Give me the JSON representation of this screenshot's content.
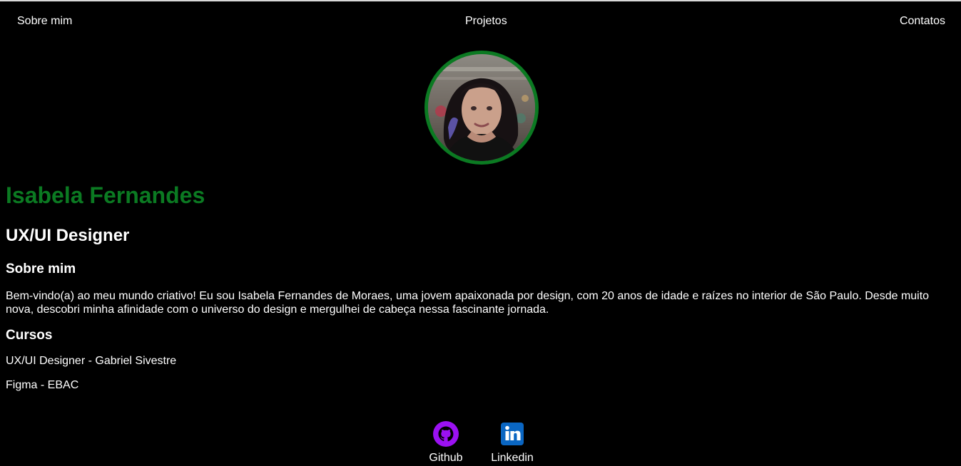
{
  "nav": {
    "items": [
      {
        "label": "Sobre mim"
      },
      {
        "label": "Projetos"
      },
      {
        "label": "Contatos"
      }
    ]
  },
  "profile": {
    "avatar_icon": "profile-photo",
    "name": "Isabela Fernandes",
    "role": "UX/UI Designer"
  },
  "about": {
    "title": "Sobre mim",
    "text": "Bem-vindo(a) ao meu mundo criativo! Eu sou Isabela Fernandes de Moraes, uma jovem apaixonada por design, com 20 anos de idade e raízes no interior de São Paulo. Desde muito nova, descobri minha afinidade com o universo do design e mergulhei de cabeça nessa fascinante jornada."
  },
  "courses": {
    "title": "Cursos",
    "items": [
      {
        "text": "UX/UI Designer - Gabriel Sivestre"
      },
      {
        "text": "Figma - EBAC"
      }
    ]
  },
  "footer": {
    "links": [
      {
        "label": "Github",
        "icon": "github-icon",
        "color": "#9b11f2"
      },
      {
        "label": "Linkedin",
        "icon": "linkedin-icon",
        "color": "#0a66c2"
      }
    ]
  },
  "colors": {
    "accent": "#0b7a22",
    "background": "#000000",
    "text": "#ffffff"
  }
}
